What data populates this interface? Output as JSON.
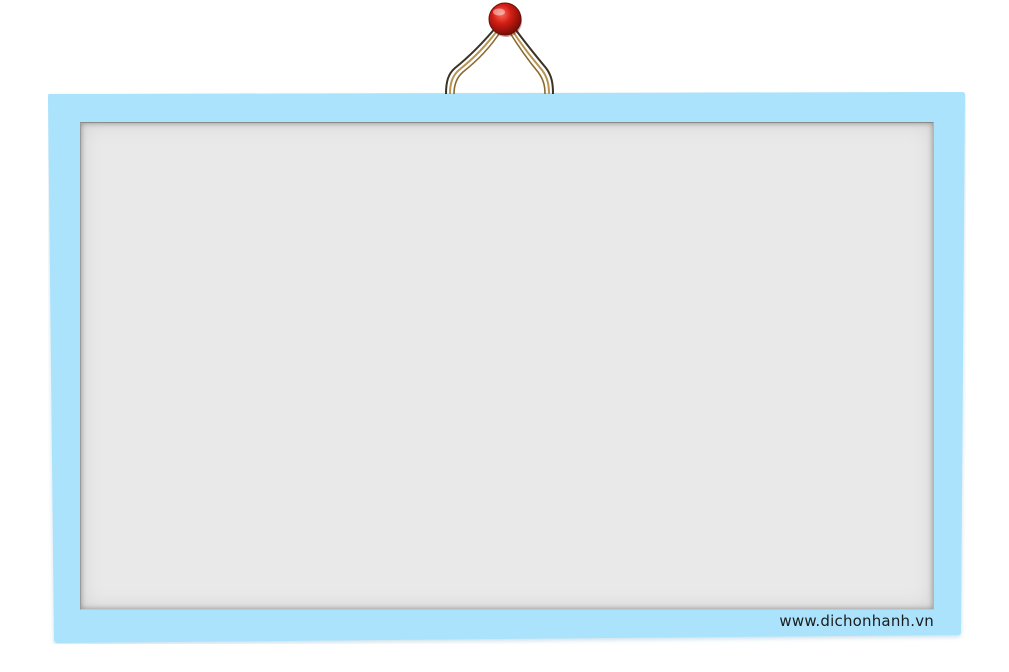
{
  "watermark": {
    "text": "www.dichonhanh.vn"
  },
  "colors": {
    "frame": "#abe3fc",
    "frame_edge": "#95d4f0",
    "board": "#e9e9e9",
    "pin": "#c21810",
    "cord": "#9a7a3a"
  },
  "icons": {
    "pin": "pushpin-icon",
    "cord": "hanging-cord-icon"
  }
}
